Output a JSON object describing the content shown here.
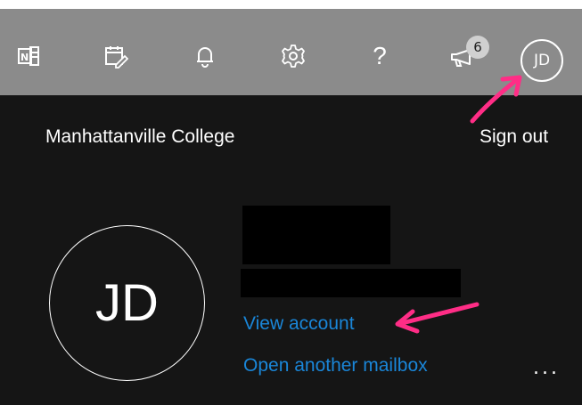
{
  "topbar": {
    "icons": [
      "onenote-icon",
      "calendar-edit-icon",
      "bell-icon",
      "gear-icon",
      "help-icon",
      "megaphone-icon"
    ],
    "help_label": "?",
    "notification_count": "6",
    "avatar_initials": "JD"
  },
  "account_panel": {
    "organization": "Manhattanville College",
    "sign_out_label": "Sign out",
    "avatar_initials": "JD",
    "view_account_label": "View account",
    "open_mailbox_label": "Open another mailbox",
    "more_label": "...",
    "link_color": "#1a86d8"
  },
  "annotations": {
    "arrow_color": "#ff2d86"
  }
}
